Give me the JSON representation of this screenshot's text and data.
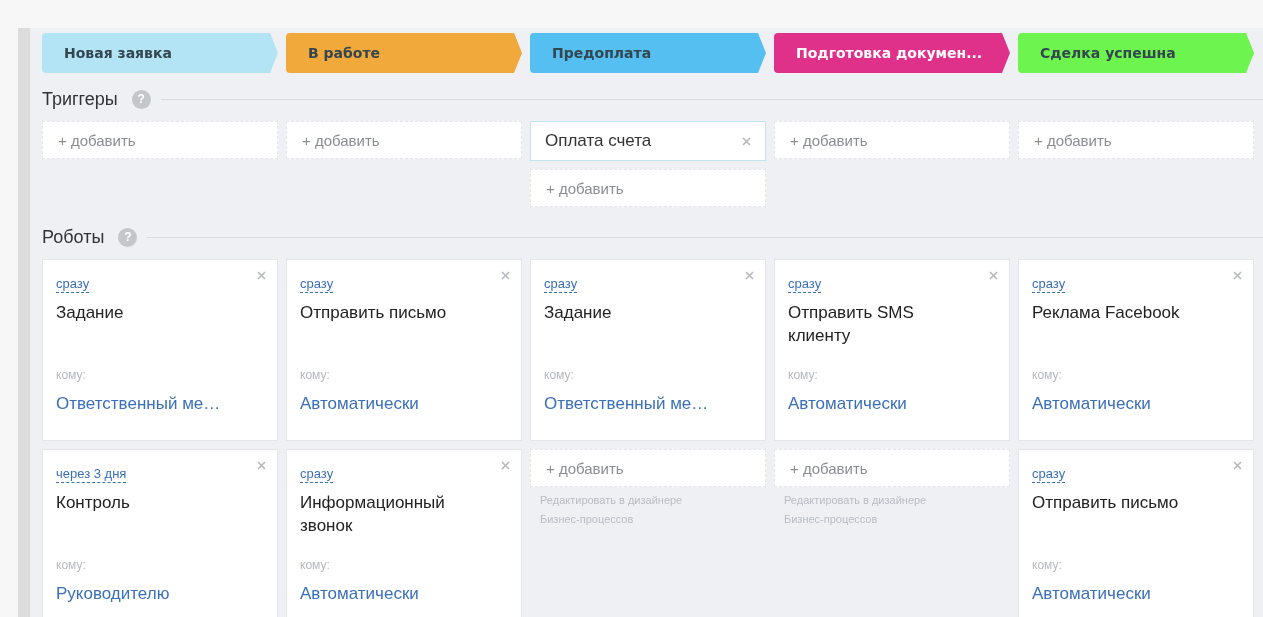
{
  "stages": [
    {
      "label": "Новая заявка",
      "color": "#b3e4f6"
    },
    {
      "label": "В работе",
      "color": "#f2a93b"
    },
    {
      "label": "Предоплата",
      "color": "#55bff2"
    },
    {
      "label": "Подготовка докумен...",
      "color": "#e0318a"
    },
    {
      "label": "Сделка успешна",
      "color": "#6ef44e"
    }
  ],
  "triggers": {
    "title": "Триггеры",
    "help": "?",
    "columns": [
      [
        {
          "kind": "add",
          "label": "+ добавить"
        }
      ],
      [
        {
          "kind": "add",
          "label": "+ добавить"
        }
      ],
      [
        {
          "kind": "trigger",
          "label": "Оплата счета"
        },
        {
          "kind": "add",
          "label": "+ добавить"
        }
      ],
      [
        {
          "kind": "add",
          "label": "+ добавить"
        }
      ],
      [
        {
          "kind": "add",
          "label": "+ добавить"
        }
      ]
    ]
  },
  "robots": {
    "title": "Роботы",
    "help": "?",
    "columns": [
      [
        {
          "kind": "robot",
          "when": "сразу",
          "name": "Задание",
          "to_label": "кому:",
          "to": "Ответственный ме…"
        },
        {
          "kind": "robot",
          "when": "через 3 дня",
          "name": "Контроль",
          "to_label": "кому:",
          "to": "Руководителю"
        }
      ],
      [
        {
          "kind": "robot",
          "when": "сразу",
          "name": "Отправить письмо",
          "to_label": "кому:",
          "to": "Автоматически"
        },
        {
          "kind": "robot",
          "when": "сразу",
          "name": "Информационный звонок",
          "to_label": "кому:",
          "to": "Автоматически"
        }
      ],
      [
        {
          "kind": "robot",
          "when": "сразу",
          "name": "Задание",
          "to_label": "кому:",
          "to": "Ответственный ме…"
        },
        {
          "kind": "add",
          "label": "+ добавить",
          "hint": "Редактировать в дизайнере Бизнес-процессов"
        }
      ],
      [
        {
          "kind": "robot",
          "when": "сразу",
          "name": "Отправить SMS клиенту",
          "to_label": "кому:",
          "to": "Автоматически"
        },
        {
          "kind": "add",
          "label": "+ добавить",
          "hint": "Редактировать в дизайнере Бизнес-процессов"
        }
      ],
      [
        {
          "kind": "robot",
          "when": "сразу",
          "name": "Реклама Facebook",
          "to_label": "кому:",
          "to": "Автоматически"
        },
        {
          "kind": "robot",
          "when": "сразу",
          "name": "Отправить письмо",
          "to_label": "кому:",
          "to": "Автоматически"
        }
      ]
    ]
  }
}
